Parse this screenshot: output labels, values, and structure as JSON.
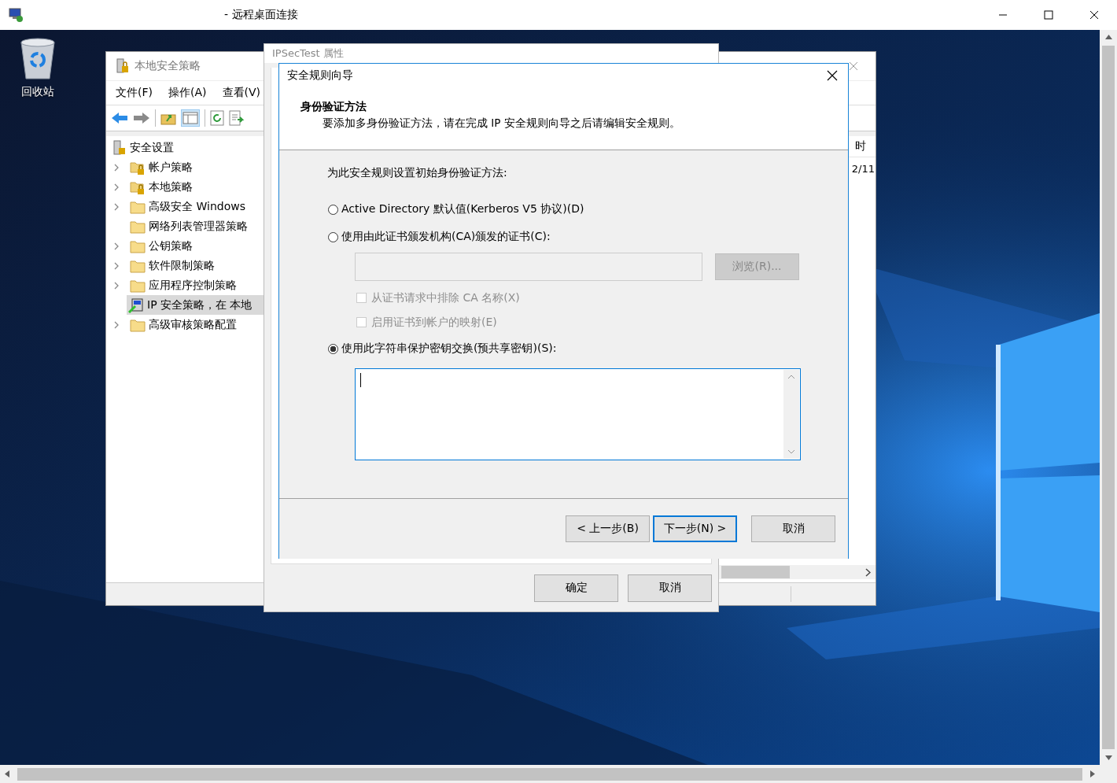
{
  "rdp_window": {
    "title": "- 远程桌面连接"
  },
  "desktop_icons": [
    {
      "label": "回收站"
    }
  ],
  "security_policy_window": {
    "title": "本地安全策略",
    "menu": [
      "文件(F)",
      "操作(A)",
      "查看(V)"
    ],
    "tree": {
      "label": "安全设置",
      "children": [
        {
          "label": "帐户策略",
          "kind": "locked-folder",
          "expandable": true,
          "selected": false
        },
        {
          "label": "本地策略",
          "kind": "locked-folder",
          "expandable": true,
          "selected": false
        },
        {
          "label": "高级安全 Windows",
          "kind": "folder",
          "expandable": true,
          "selected": false
        },
        {
          "label": "网络列表管理器策略",
          "kind": "folder",
          "expandable": false,
          "selected": false
        },
        {
          "label": "公钥策略",
          "kind": "folder",
          "expandable": true,
          "selected": false
        },
        {
          "label": "软件限制策略",
          "kind": "folder",
          "expandable": true,
          "selected": false
        },
        {
          "label": "应用程序控制策略",
          "kind": "folder",
          "expandable": true,
          "selected": false
        },
        {
          "label": "IP 安全策略，在 本地",
          "kind": "ip-policy",
          "expandable": false,
          "selected": true
        },
        {
          "label": "高级审核策略配置",
          "kind": "folder",
          "expandable": true,
          "selected": false
        }
      ]
    },
    "column_header": "时",
    "row_cell": "2/11"
  },
  "properties_dialog": {
    "title": "IPSecTest 属性",
    "buttons": [
      "确定",
      "取消"
    ]
  },
  "wizard": {
    "title": "安全规则向导",
    "heading": "身份验证方法",
    "subheading": "要添加多身份验证方法，请在完成 IP 安全规则向导之后请编辑安全规则。",
    "prompt": "为此安全规则设置初始身份验证方法:",
    "auth_options": [
      {
        "label": "Active Directory 默认值(Kerberos V5 协议)(D)",
        "selected": false
      },
      {
        "label": "使用由此证书颁发机构(CA)颁发的证书(C):",
        "selected": false
      },
      {
        "label": "使用此字符串保护密钥交换(预共享密钥)(S):",
        "selected": true
      }
    ],
    "browse_button": {
      "label": "浏览(R)...",
      "disabled": true
    },
    "cert_options": [
      {
        "label": "从证书请求中排除 CA 名称(X)",
        "checked": false,
        "disabled": true
      },
      {
        "label": "启用证书到帐户的映射(E)",
        "checked": false,
        "disabled": true
      }
    ],
    "buttons": [
      {
        "label": "< 上一步(B)",
        "default": false
      },
      {
        "label": "下一步(N) >",
        "default": true
      },
      {
        "label": "取消",
        "default": false
      }
    ]
  }
}
